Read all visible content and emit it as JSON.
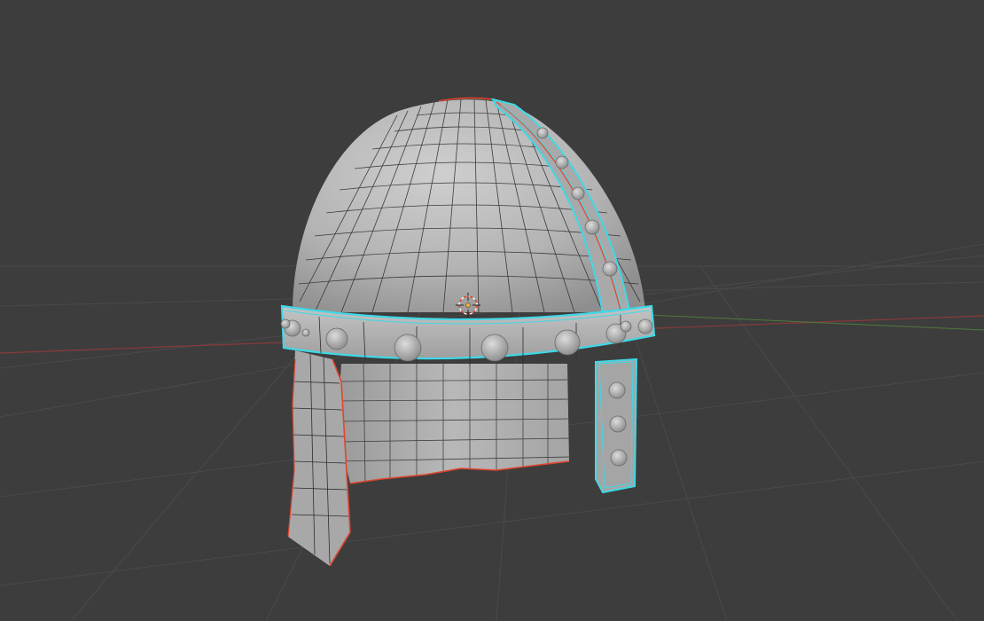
{
  "viewport": {
    "mode": "3d-viewport",
    "shading": "solid",
    "background_color": "#3d3d3d",
    "grid_color": "#4a4a4a",
    "x_axis_color": "#8a3a3a",
    "y_axis_color": "#4f7a3a"
  },
  "object": {
    "kind": "helmet-mesh",
    "surface_color": "#b4b4b4",
    "wire_color": "#2e2e2e",
    "selected_outline_color": "#3fd8e6",
    "seam_color": "#e0452f",
    "rivets_on_band": 10,
    "rivets_on_nose_strip": 8
  },
  "cursor": {
    "icon": "3d-cursor-icon"
  }
}
